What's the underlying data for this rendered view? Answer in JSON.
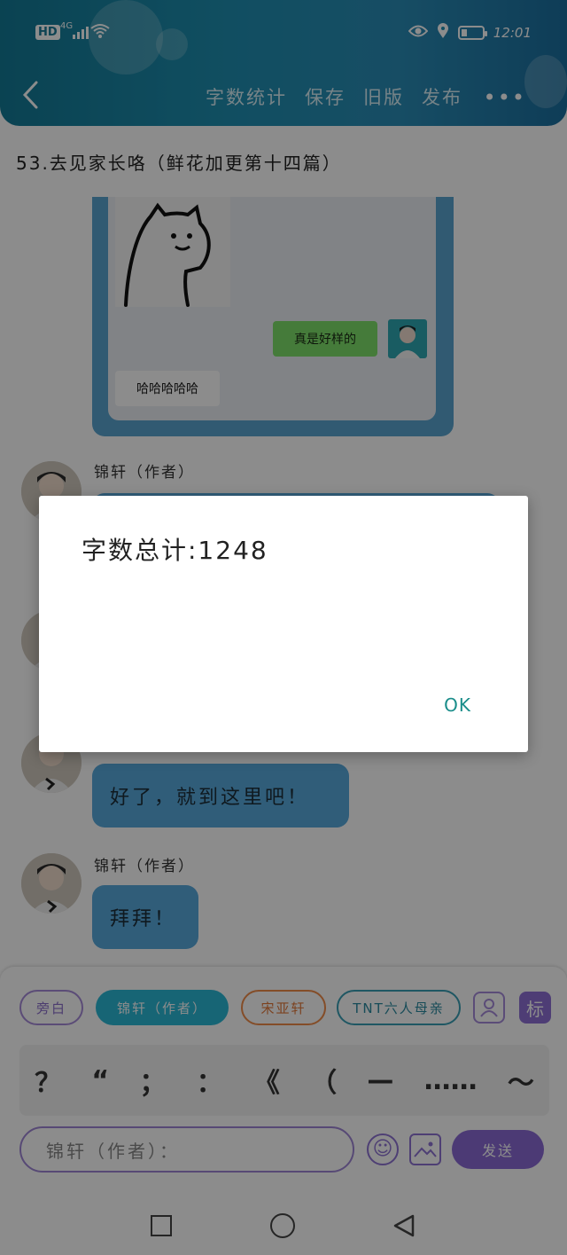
{
  "status_bar": {
    "hd": "HD",
    "network": "4G",
    "time": "12:01"
  },
  "header": {
    "menu": [
      "字数统计",
      "保存",
      "旧版",
      "发布"
    ],
    "more": "•••"
  },
  "title": "53.去见家长咯（鲜花加更第十四篇）",
  "screenshot": {
    "green_text": "真是好样的",
    "white_text": "哈哈哈哈哈"
  },
  "messages": [
    {
      "speaker": "锦轩（作者）",
      "text": ""
    },
    {
      "speaker": "",
      "text": "好了，就到这里吧！"
    },
    {
      "speaker": "锦轩（作者）",
      "text": "拜拜！"
    }
  ],
  "composer": {
    "chips": [
      "旁白",
      "锦轩（作者）",
      "宋亚轩",
      "TNT六人母亲"
    ],
    "mark_label": "标",
    "punctuation": [
      "？",
      "“",
      "；",
      "：",
      "《",
      "（",
      "—",
      "……",
      "～"
    ],
    "input_placeholder": "锦轩（作者）：",
    "send_label": "发送"
  },
  "dialog": {
    "message": "字数总计:1248",
    "ok_label": "OK"
  }
}
